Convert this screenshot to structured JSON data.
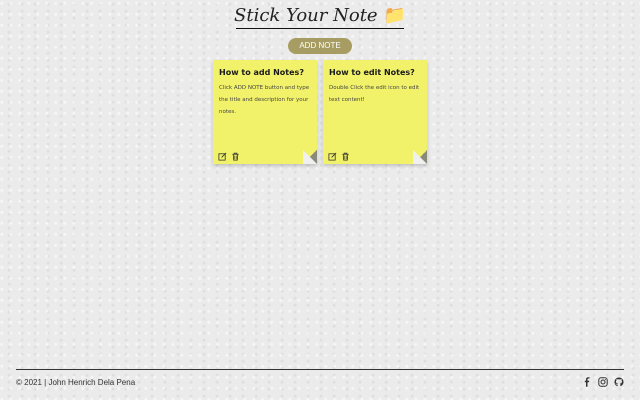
{
  "header": {
    "title": "Stick Your Note",
    "emoji": "📁"
  },
  "toolbar": {
    "add_label": "ADD NOTE"
  },
  "notes": [
    {
      "title": "How to add Notes?",
      "description": "Click ADD NOTE button and type the title and description for your notes."
    },
    {
      "title": "How to edit Notes?",
      "description": "Double Click the edit icon to edit text content!"
    }
  ],
  "footer": {
    "copyright": "© 2021 | John Henrich Dela Pena",
    "icons": [
      "facebook-icon",
      "instagram-icon",
      "github-icon"
    ]
  },
  "colors": {
    "note": "#f2f26a",
    "button": "#a79d62",
    "background": "#ebebeb"
  }
}
